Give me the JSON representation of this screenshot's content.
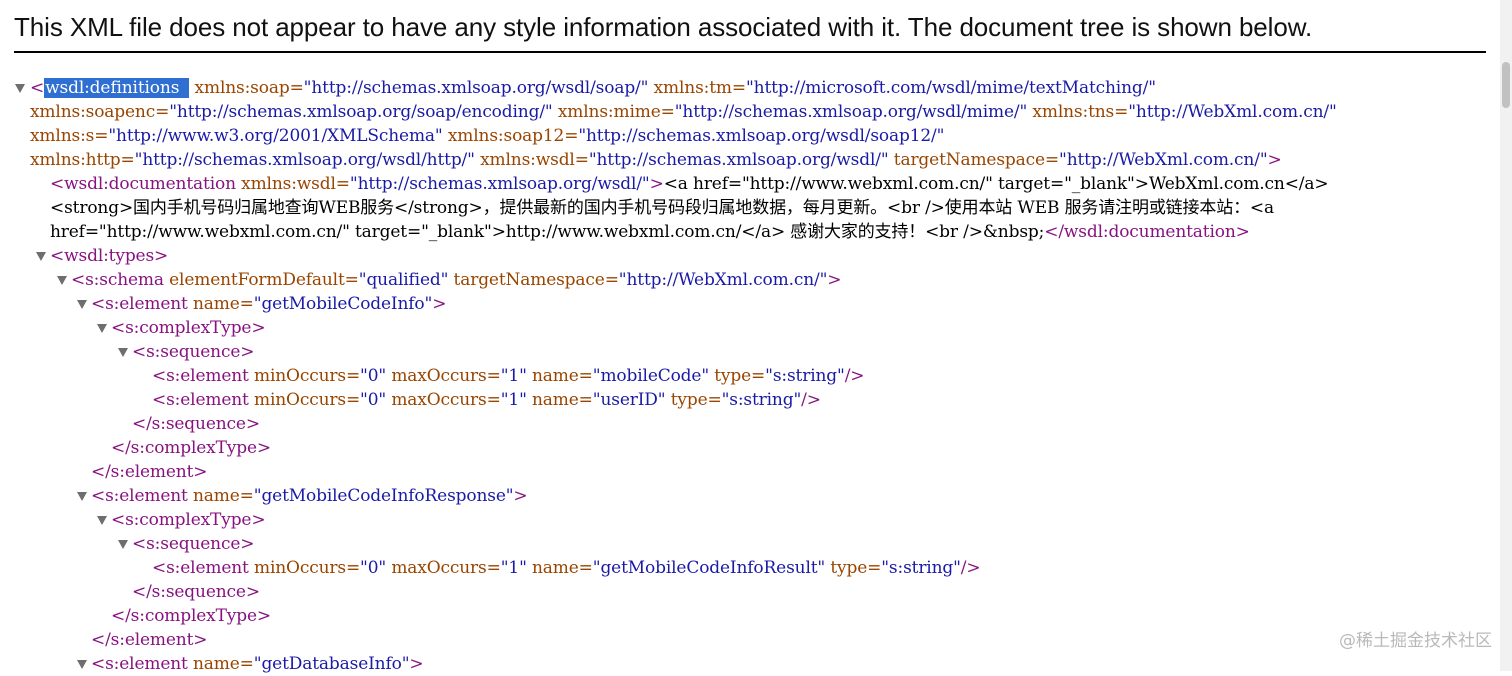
{
  "header": {
    "message": "This XML file does not appear to have any style information associated with it. The document tree is shown below."
  },
  "tree": {
    "root_open_bracket": "<",
    "root_selected_tag": "wsdl:definitions",
    "root_line1_attrs": [
      {
        "name": "xmlns:soap",
        "value": "http://schemas.xmlsoap.org/wsdl/soap/"
      },
      {
        "name": "xmlns:tm",
        "value": "http://microsoft.com/wsdl/mime/textMatching/"
      }
    ],
    "root_line2_attrs": [
      {
        "name": "xmlns:soapenc",
        "value": "http://schemas.xmlsoap.org/soap/encoding/"
      },
      {
        "name": "xmlns:mime",
        "value": "http://schemas.xmlsoap.org/wsdl/mime/"
      },
      {
        "name": "xmlns:tns",
        "value": "http://WebXml.com.cn/"
      }
    ],
    "root_line3_attrs": [
      {
        "name": "xmlns:s",
        "value": "http://www.w3.org/2001/XMLSchema"
      },
      {
        "name": "xmlns:soap12",
        "value": "http://schemas.xmlsoap.org/wsdl/soap12/"
      }
    ],
    "root_line4_attrs": [
      {
        "name": "xmlns:http",
        "value": "http://schemas.xmlsoap.org/wsdl/http/"
      },
      {
        "name": "xmlns:wsdl",
        "value": "http://schemas.xmlsoap.org/wsdl/"
      },
      {
        "name": "targetNamespace",
        "value": "http://WebXml.com.cn/"
      }
    ],
    "doc_open_tag": "wsdl:documentation",
    "doc_attr_name": "xmlns:wsdl",
    "doc_attr_value": "http://schemas.xmlsoap.org/wsdl/",
    "doc_text_line1": "<a href=\"http://www.webxml.com.cn/\" target=\"_blank\">WebXml.com.cn</a>",
    "doc_text_line2": "<strong>国内手机号码归属地查询WEB服务</strong>，提供最新的国内手机号码段归属地数据，每月更新。<br />使用本站 WEB 服务请注明或链接本站：<a",
    "doc_text_line3": "href=\"http://www.webxml.com.cn/\" target=\"_blank\">http://www.webxml.com.cn/</a> 感谢大家的支持！<br />&nbsp;",
    "doc_close_tag": "</wsdl:documentation>",
    "types_tag": "wsdl:types",
    "schema_tag": "s:schema",
    "schema_attr1_name": "elementFormDefault",
    "schema_attr1_value": "qualified",
    "schema_attr2_name": "targetNamespace",
    "schema_attr2_value": "http://WebXml.com.cn/",
    "element_tag": "s:element",
    "element_close": "</s:element>",
    "complex_tag": "s:complexType",
    "complex_close": "</s:complexType>",
    "sequence_tag": "s:sequence",
    "sequence_close": "</s:sequence>",
    "attr_name": "name",
    "attr_minOccurs": "minOccurs",
    "attr_maxOccurs": "maxOccurs",
    "attr_type": "type",
    "val_min": "0",
    "val_max": "1",
    "val_string": "s:string",
    "el1_name": "getMobileCodeInfo",
    "el1_field1": "mobileCode",
    "el1_field2": "userID",
    "el2_name": "getMobileCodeInfoResponse",
    "el2_field1": "getMobileCodeInfoResult",
    "el3_name": "getDatabaseInfo"
  },
  "watermark": "@稀土掘金技术社区"
}
